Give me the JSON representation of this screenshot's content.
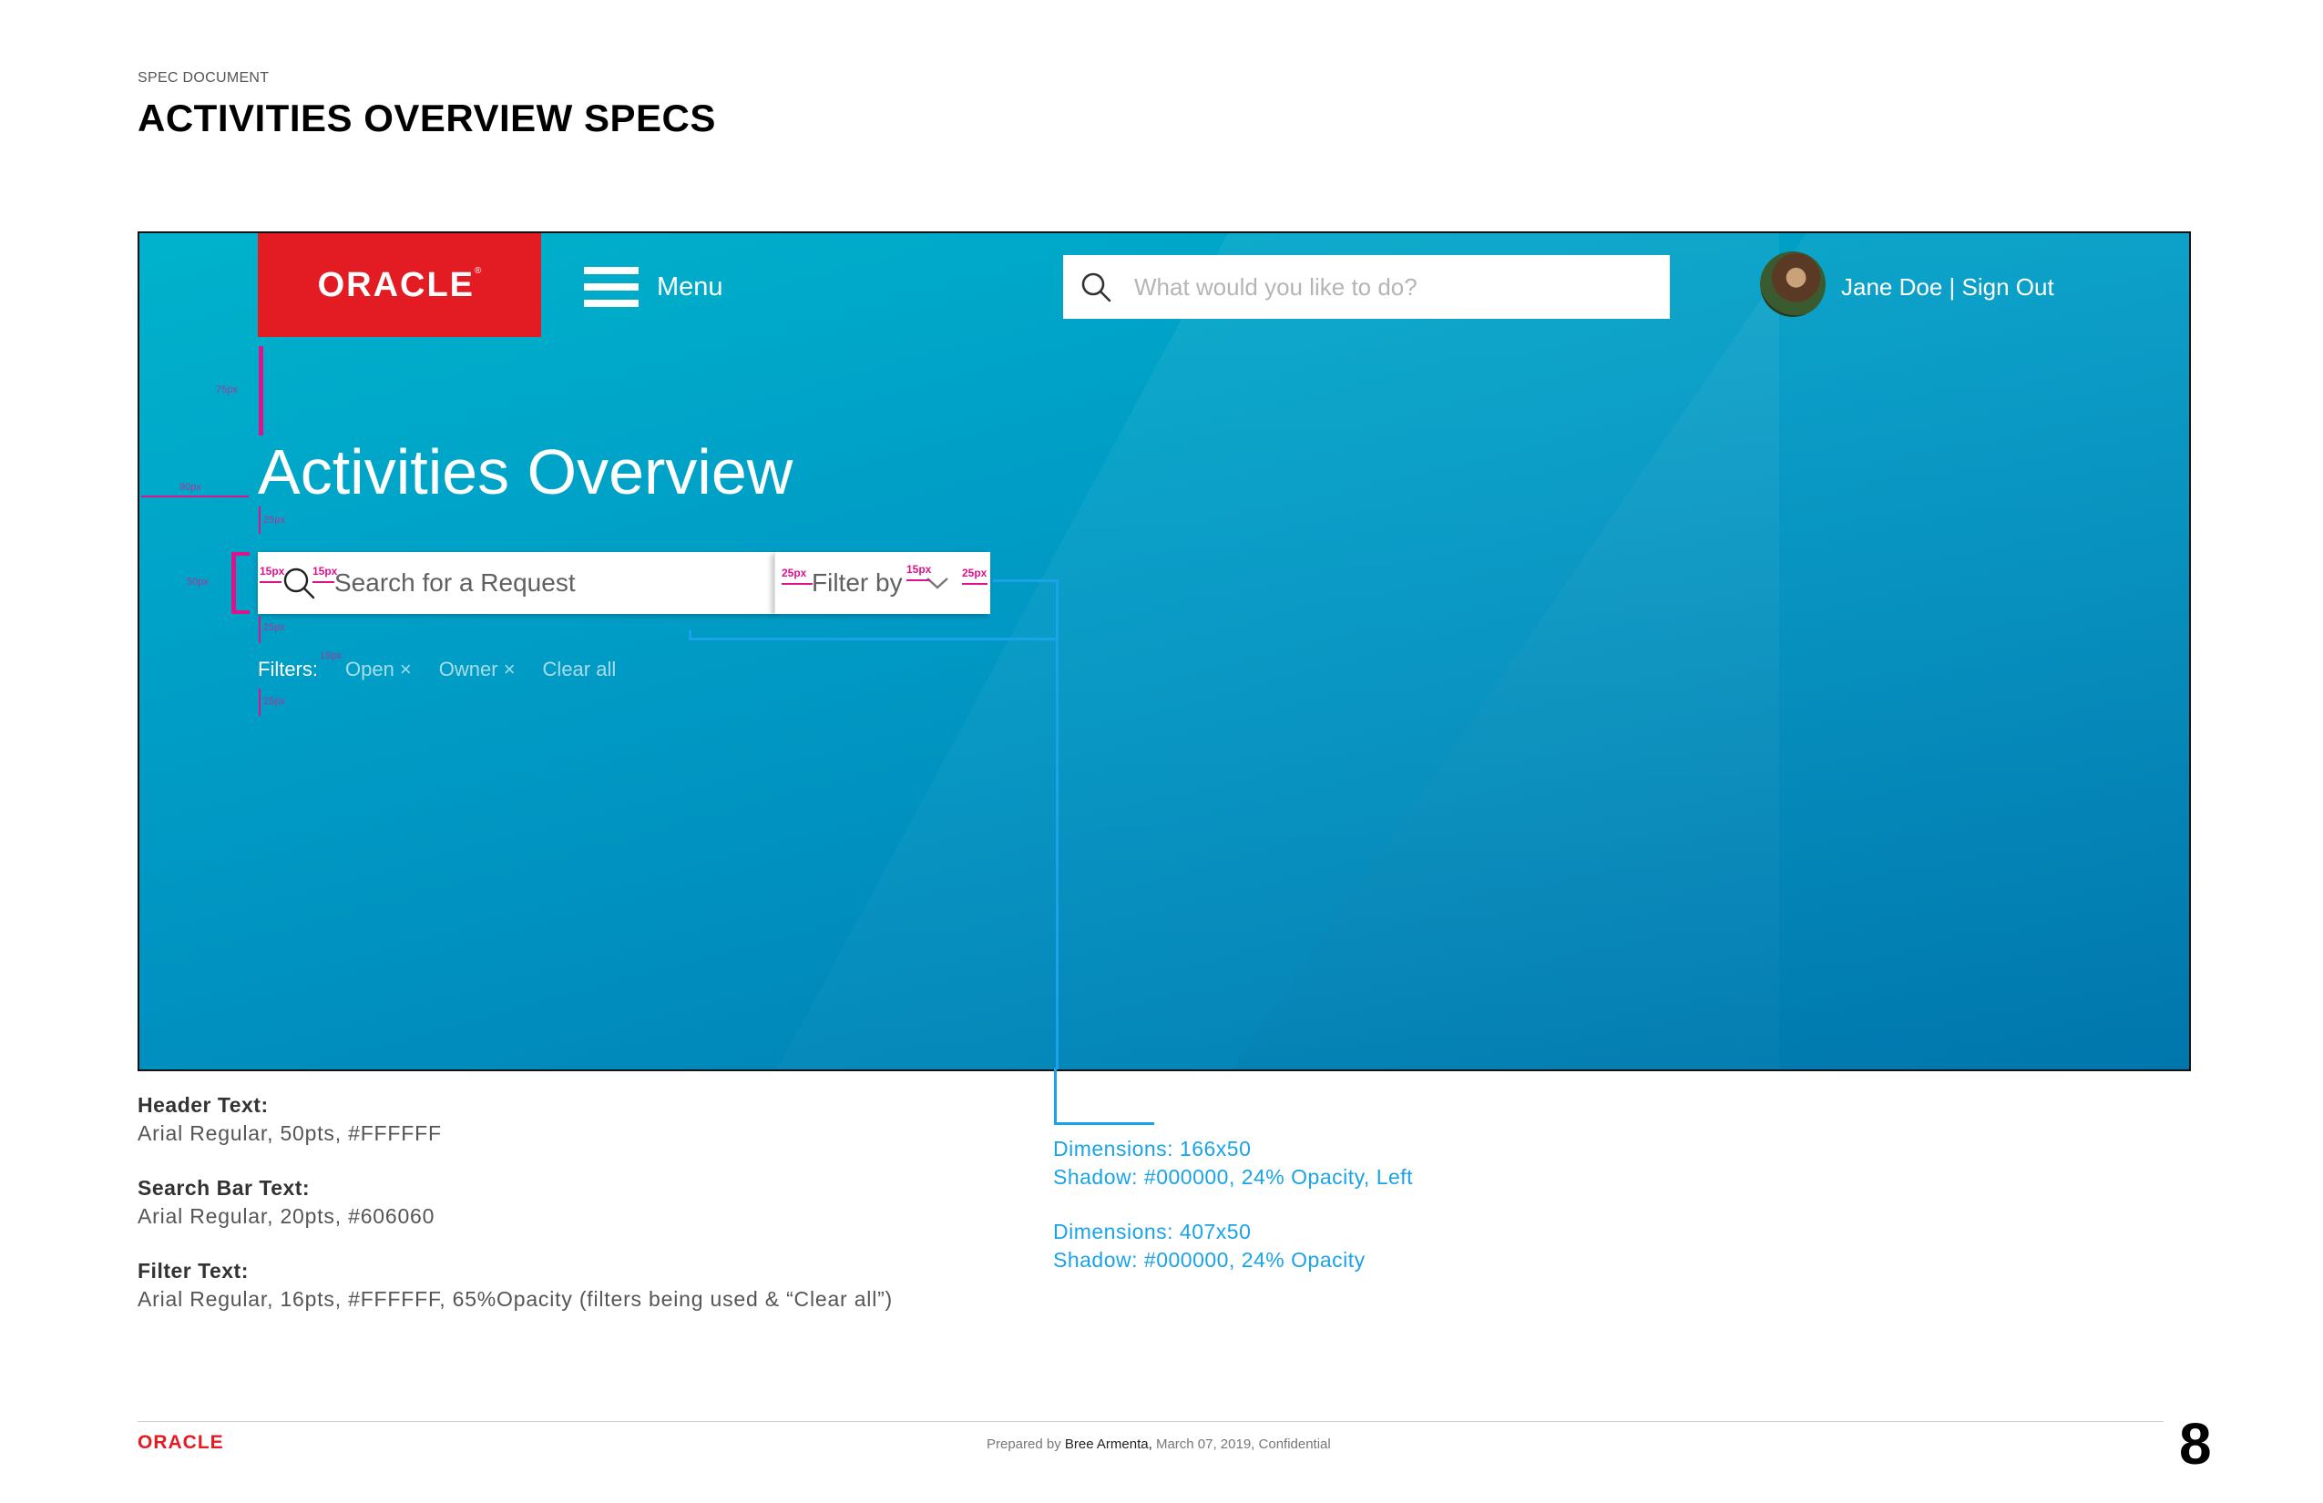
{
  "doc": {
    "label": "SPEC DOCUMENT",
    "title": "ACTIVITIES OVERVIEW SPECS"
  },
  "mockup": {
    "brand": {
      "logo_text": "ORACLE",
      "logo_mark": "®",
      "logo_color": "#e31b23"
    },
    "nav": {
      "menu_label": "Menu",
      "menu_icon": "hamburger-icon"
    },
    "top_search": {
      "placeholder": "What would you like to do?",
      "icon": "search-icon"
    },
    "user": {
      "name_link": "Jane Doe | Sign Out",
      "avatar_icon": "avatar"
    },
    "heading": "Activities Overview",
    "request_search": {
      "placeholder": "Search for a Request",
      "icon": "search-icon"
    },
    "filter_select": {
      "label": "Filter by",
      "icon": "chevron-down-icon"
    },
    "filters": {
      "label": "Filters:",
      "chips": [
        "Open ×",
        "Owner ×"
      ],
      "clear": "Clear all"
    },
    "annotations": {
      "px_15": "15px",
      "px_25": "25px",
      "px_faint_a": "75px",
      "px_faint_b": "90px",
      "px_faint_c": "25px",
      "px_faint_d": "50px",
      "px_faint_e": "25px",
      "px_faint_f": "15px",
      "px_faint_g": "25px"
    },
    "colors": {
      "gradient_top": "#00b3cc",
      "gradient_bottom": "#0078b0",
      "annotation": "#e0128a",
      "callout": "#1aa3e8"
    }
  },
  "specs": [
    {
      "heading": "Header Text:",
      "value": "Arial Regular, 50pts, #FFFFFF"
    },
    {
      "heading": "Search Bar Text:",
      "value": "Arial Regular, 20pts, #606060"
    },
    {
      "heading": "Filter Text:",
      "value": "Arial Regular, 16pts, #FFFFFF, 65%Opacity (filters being used & “Clear all”)"
    }
  ],
  "callouts": [
    {
      "dimensions": "Dimensions: 166x50",
      "shadow": "Shadow: #000000, 24% Opacity, Left"
    },
    {
      "dimensions": "Dimensions: 407x50",
      "shadow": "Shadow: #000000, 24% Opacity"
    }
  ],
  "footer": {
    "logo": "ORACLE",
    "prepared_prefix": "Prepared by ",
    "author": "Bree Armenta,",
    "prepared_suffix": " March 07, 2019, Confidential",
    "page_number": "8"
  }
}
